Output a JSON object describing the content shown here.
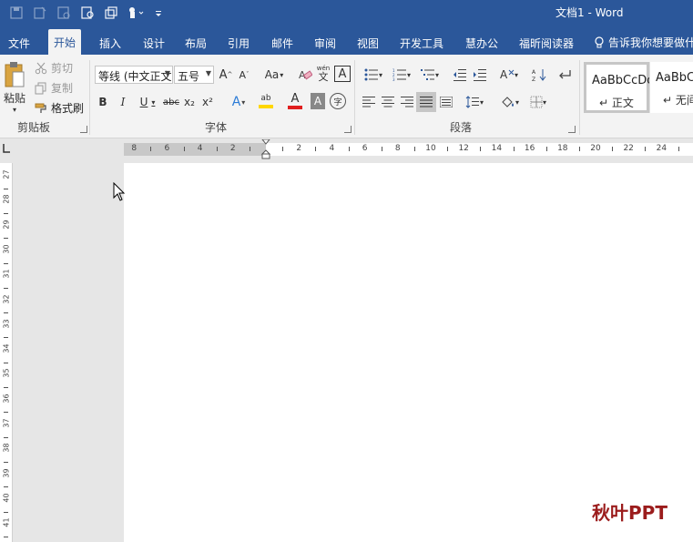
{
  "window": {
    "title": "文档1  -  Word"
  },
  "quick_access": [
    {
      "icon": "save-icon"
    },
    {
      "icon": "save-as-icon"
    },
    {
      "icon": "open-icon"
    },
    {
      "icon": "print-preview-icon"
    },
    {
      "icon": "copy-format-icon"
    },
    {
      "icon": "touch-mode-icon"
    },
    {
      "icon": "customize-qat-icon"
    }
  ],
  "tabs": [
    {
      "label": "文件"
    },
    {
      "label": "开始",
      "active": true
    },
    {
      "label": "插入"
    },
    {
      "label": "设计"
    },
    {
      "label": "布局"
    },
    {
      "label": "引用"
    },
    {
      "label": "邮件"
    },
    {
      "label": "审阅"
    },
    {
      "label": "视图"
    },
    {
      "label": "开发工具"
    },
    {
      "label": "慧办公"
    },
    {
      "label": "福昕阅读器"
    }
  ],
  "tell_me": "告诉我你想要做什",
  "ribbon": {
    "clipboard": {
      "group_label": "剪贴板",
      "paste": "粘贴",
      "cut": "剪切",
      "copy": "复制",
      "format_painter": "格式刷"
    },
    "font": {
      "group_label": "字体",
      "font_name": "等线 (中文正文",
      "font_size": "五号",
      "grow": "A",
      "shrink": "A",
      "change_case": "Aa",
      "phonetic_top": "wén",
      "phonetic_bottom": "文",
      "char_border": "A",
      "bold": "B",
      "italic": "I",
      "underline": "U",
      "strikethrough": "abc",
      "subscript": "x₂",
      "superscript": "x²",
      "text_effects": "A",
      "highlight": "ab",
      "font_color": "A",
      "char_shading": "A",
      "enclose": "字"
    },
    "paragraph": {
      "group_label": "段落"
    },
    "styles": [
      {
        "sample": "AaBbCcDc",
        "name": "正文"
      },
      {
        "sample": "AaBbCc",
        "name": "无间"
      }
    ]
  },
  "ruler": {
    "h_labels": [
      "8",
      "6",
      "4",
      "2",
      "2",
      "4",
      "6",
      "8",
      "10",
      "12",
      "14",
      "16",
      "18",
      "20",
      "22",
      "24"
    ],
    "v_labels": [
      "27",
      "28",
      "29",
      "30",
      "31",
      "32",
      "33",
      "34",
      "35",
      "36",
      "37",
      "38",
      "39",
      "40",
      "41"
    ]
  },
  "watermark": "秋叶PPT",
  "colors": {
    "brand": "#2b579a",
    "ribbon_bg": "#f3f3f3",
    "highlight_yellow": "#ffd700",
    "font_red": "#e01e1e",
    "watermark": "#9b1c1c"
  }
}
